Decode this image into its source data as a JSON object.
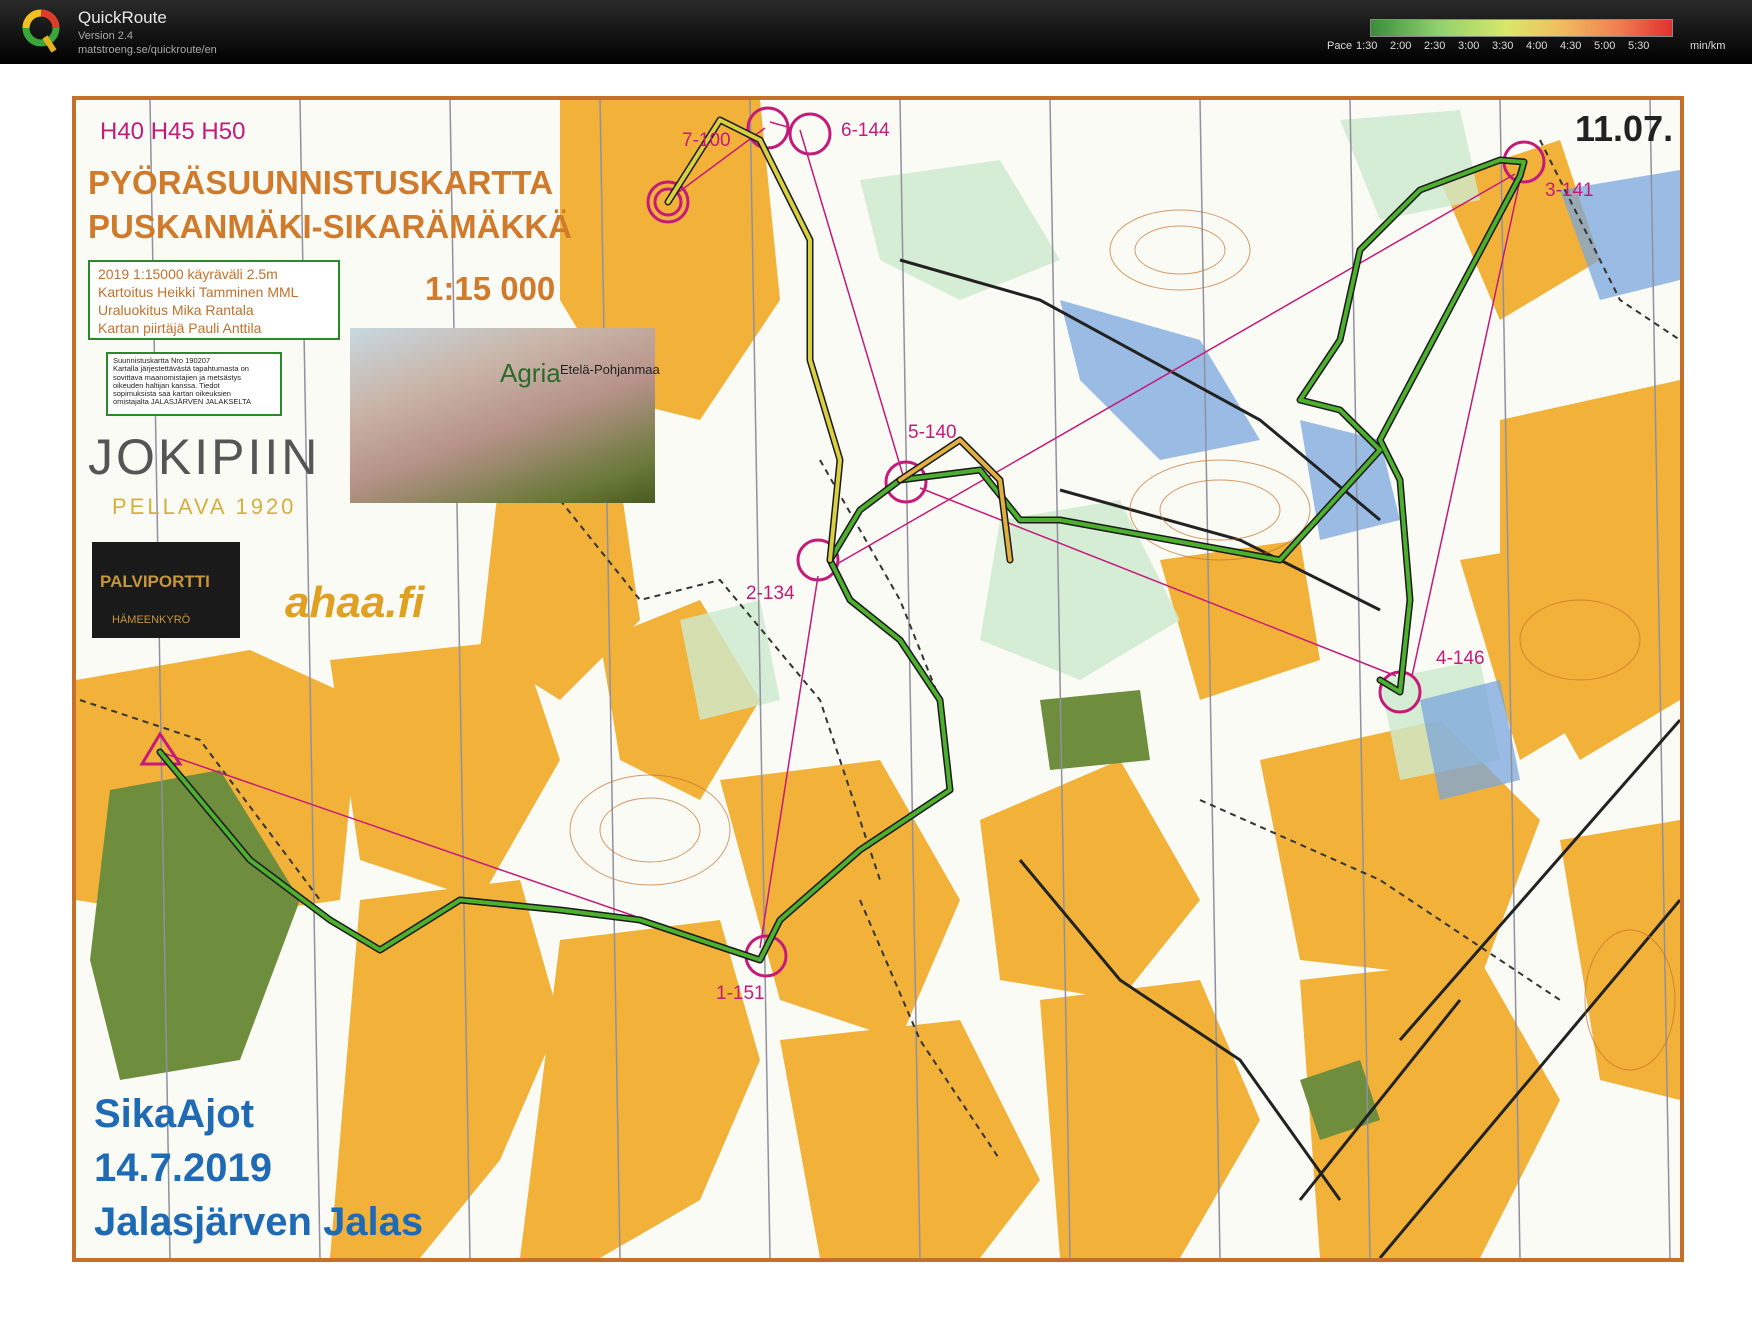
{
  "app": {
    "name": "QuickRoute",
    "version": "Version 2.4",
    "url": "matstroeng.se/quickroute/en"
  },
  "pace": {
    "label": "Pace",
    "ticks": [
      "1:30",
      "2:00",
      "2:30",
      "3:00",
      "3:30",
      "4:00",
      "4:30",
      "5:00",
      "5:30"
    ],
    "unit": "min/km"
  },
  "map": {
    "classes": "H40 H45 H50",
    "title_line1": "PYÖRÄSUUNNISTUSKARTTA",
    "title_line2": "PUSKANMÄKI-SIKARÄMÄKKÄ",
    "scale": "1:15 000",
    "date": "11.07.",
    "credits": [
      "2019    1:15000    käyräväli 2.5m",
      "Kartoitus Heikki Tamminen MML",
      "Uraluokitus Mika Rantala",
      "Kartan piirtäjä Pauli Anttila"
    ],
    "notice": [
      "Suunnistuskartta Nro 190207",
      "Kartalla järjestettävästä tapahtumasta on",
      "sovittava maanomistajien ja metsästys",
      "oikeuden haltijan kanssa. Tiedot",
      "sopimuksista saa kartan oikeuksien",
      "omistajalta  JALASJÄRVEN JALAKSELTA"
    ],
    "sponsors": {
      "jokipiin": "JOKIPIIN",
      "jokipiin_sub": "PELLAVA 1920",
      "agria": "Agria",
      "agria_region": "Etelä-Pohjanmaa",
      "palviportti": "PALVIPORTTI",
      "palviportti_sub": "HÄMEENKYRÖ",
      "ahaa": "ahaa.fi"
    },
    "event": {
      "name": "SikaAjot",
      "date": "14.7.2019",
      "organizer": "Jalasjärven Jalas"
    },
    "controls": [
      "1-151",
      "2-134",
      "3-141",
      "4-146",
      "5-140",
      "6-144",
      "7-100"
    ]
  }
}
